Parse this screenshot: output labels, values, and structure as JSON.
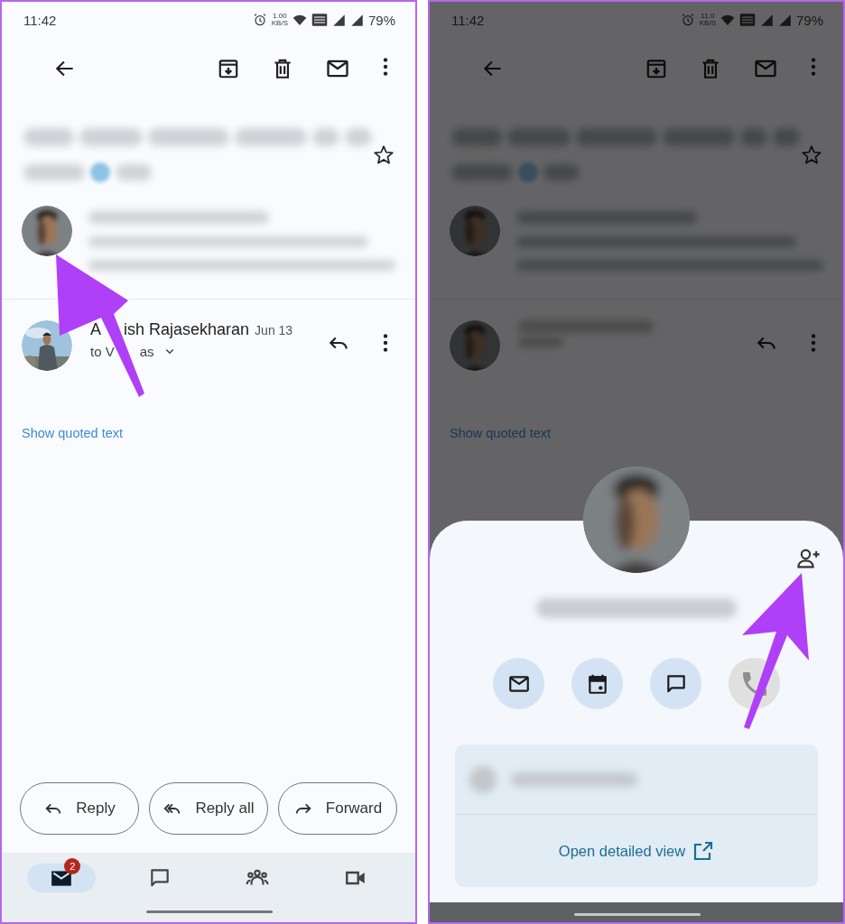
{
  "screens": [
    {
      "dimmed": false,
      "status_bar": {
        "time": "11:42",
        "speed": "1.00",
        "speed_unit": "KB/S",
        "battery": "79%"
      },
      "message": {
        "sender": [
          "A",
          "ish Rajasekharan"
        ],
        "date": "Jun 13",
        "recipient": [
          "to V",
          "as"
        ]
      },
      "show_quoted": "Show quoted text",
      "actions": [
        {
          "kind": "reply",
          "label": "Reply"
        },
        {
          "kind": "reply_all",
          "label": "Reply all"
        },
        {
          "kind": "forward",
          "label": "Forward"
        }
      ],
      "nav": [
        {
          "kind": "mail",
          "selected": true,
          "badge": "2"
        },
        {
          "kind": "chat",
          "selected": false
        },
        {
          "kind": "spaces",
          "selected": false
        },
        {
          "kind": "meet",
          "selected": false
        }
      ]
    },
    {
      "dimmed": true,
      "status_bar": {
        "time": "11:42",
        "speed": "11.0",
        "speed_unit": "KB/S",
        "battery": "79%"
      },
      "show_quoted": "Show quoted text",
      "contact_sheet": {
        "actions": [
          {
            "kind": "email",
            "disabled": false
          },
          {
            "kind": "calendar",
            "disabled": false
          },
          {
            "kind": "chat",
            "disabled": false
          },
          {
            "kind": "call",
            "disabled": true
          }
        ],
        "link": "Open detailed view"
      }
    }
  ]
}
